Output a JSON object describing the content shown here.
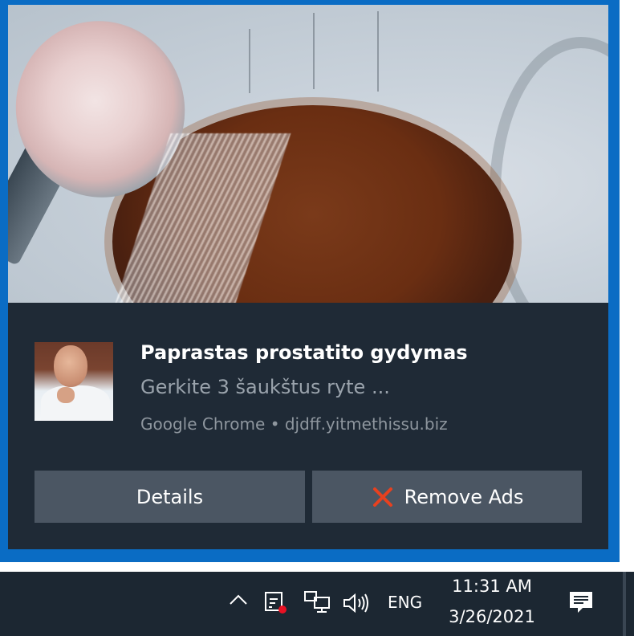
{
  "notification": {
    "title": "Paprastas prostatito gydymas",
    "body": "Gerkite 3 šaukštus ryte ...",
    "source": "Google Chrome • djdff.yitmethissu.biz",
    "buttons": {
      "details": "Details",
      "remove_ads": "Remove Ads"
    }
  },
  "taskbar": {
    "language": "ENG",
    "time": "11:31 AM",
    "date": "3/26/2021"
  },
  "icons": {
    "tray_chevron": "chevron-up-icon",
    "tray_network": "network-alert-icon",
    "tray_ethernet": "ethernet-icon",
    "tray_volume": "volume-icon",
    "action_center": "notification-center-icon",
    "remove": "close-icon"
  },
  "colors": {
    "desktop_accent": "#0a6cc4",
    "toast_background": "#1f2a36",
    "button_background": "#4b5663",
    "taskbar_background": "#1c2732",
    "alert_dot": "#e81123",
    "remove_x": "#e8411f"
  }
}
